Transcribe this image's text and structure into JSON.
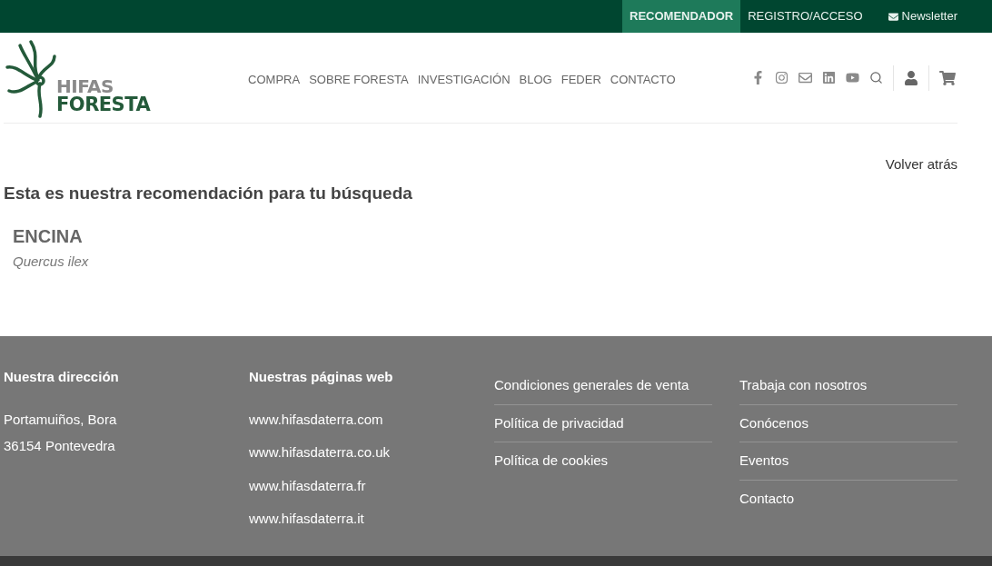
{
  "top_bar": {
    "items": [
      {
        "label": "RECOMENDADOR",
        "selected": true,
        "kind": "link"
      },
      {
        "label": "REGISTRO/ACCESO",
        "selected": false,
        "kind": "link"
      },
      {
        "label": "Newsletter",
        "selected": false,
        "kind": "mail"
      }
    ]
  },
  "header": {
    "logo": {
      "line_1": "HIFAS",
      "line_2": "FORESTA"
    },
    "nav": [
      "COMPRA",
      "SOBRE FORESTA",
      "INVESTIGACIÓN",
      "BLOG",
      "FEDER",
      "CONTACTO"
    ]
  },
  "content": {
    "back_link": "Volver atrás",
    "heading": "Esta es nuestra recomendación para tu búsqueda",
    "results": [
      {
        "name": "ENCINA",
        "latin": "Quercus ilex"
      }
    ]
  },
  "footer": {
    "columns": [
      {
        "kind": "plain",
        "title": "Nuestra dirección",
        "items": [
          "Portamuiños, Bora",
          "36154 Pontevedra"
        ]
      },
      {
        "kind": "links",
        "title": "Nuestras páginas web",
        "items": [
          "www.hifasdaterra.com",
          "www.hifasdaterra.co.uk",
          "www.hifasdaterra.fr",
          "www.hifasdaterra.it"
        ]
      },
      {
        "kind": "divided",
        "items": [
          "Condiciones generales de venta",
          "Política de privacidad",
          "Política de cookies"
        ]
      },
      {
        "kind": "divided",
        "items": [
          "Trabaja con nosotros",
          "Conócenos",
          "Eventos",
          "Contacto"
        ]
      }
    ]
  }
}
